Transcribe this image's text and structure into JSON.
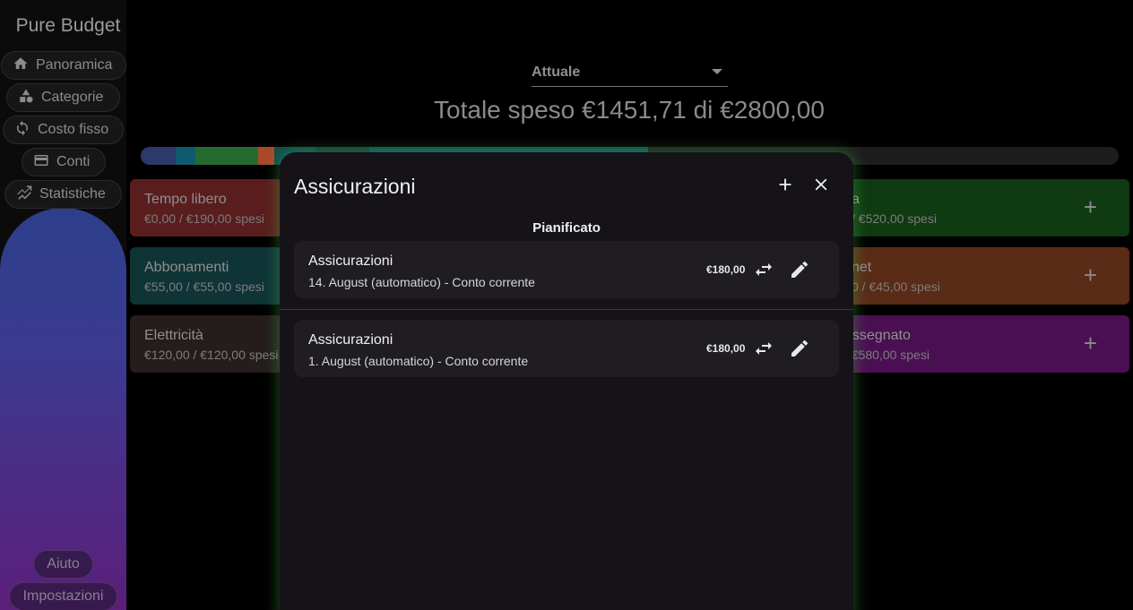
{
  "app": {
    "title": "Pure Budget"
  },
  "sidebar": {
    "items": [
      {
        "label": "Panoramica",
        "icon": "home-icon"
      },
      {
        "label": "Categorie",
        "icon": "shapes-icon"
      },
      {
        "label": "Costo fisso",
        "icon": "sync-icon"
      },
      {
        "label": "Conti",
        "icon": "wallet-icon"
      },
      {
        "label": "Statistiche",
        "icon": "chart-icon"
      }
    ],
    "help_label": "Aiuto",
    "settings_label": "Impostazioni"
  },
  "header": {
    "period_value": "Attuale",
    "total_text": "Totale speso €1451,71 di €2800,00"
  },
  "budget_bar": {
    "colors": [
      "#2b3a6b",
      "#0f5a6e",
      "#256b2f",
      "#a84a2a",
      "#0e4b4e",
      "#123d3d",
      "#0c5252"
    ]
  },
  "categories": [
    {
      "name": "Tempo libero",
      "value": "€0,00 / €190,00 spesi",
      "color": "#5a1d1d"
    },
    {
      "name": "Abbonamenti",
      "value": "€55,00 / €55,00 spesi",
      "color": "#0f3436"
    },
    {
      "name": "Elettricità",
      "value": "€120,00 / €120,00 spesi",
      "color": "#241d1c"
    },
    {
      "name": "a",
      "value": "/ €520,00 spesi",
      "color": "#0f3a12"
    },
    {
      "name": "net",
      "value": "0 / €45,00 spesi",
      "color": "#5a2b16"
    },
    {
      "name": "assegnato",
      "value": "/ €580,00 spesi",
      "color": "#4a0f52"
    }
  ],
  "modal": {
    "title": "Assicurazioni",
    "section_label": "Pianificato",
    "entries": [
      {
        "name": "Assicurazioni",
        "detail": "14. August (automatico) - Conto corrente",
        "amount": "€180,00"
      },
      {
        "name": "Assicurazioni",
        "detail": "1. August (automatico) - Conto corrente",
        "amount": "€180,00"
      }
    ]
  }
}
